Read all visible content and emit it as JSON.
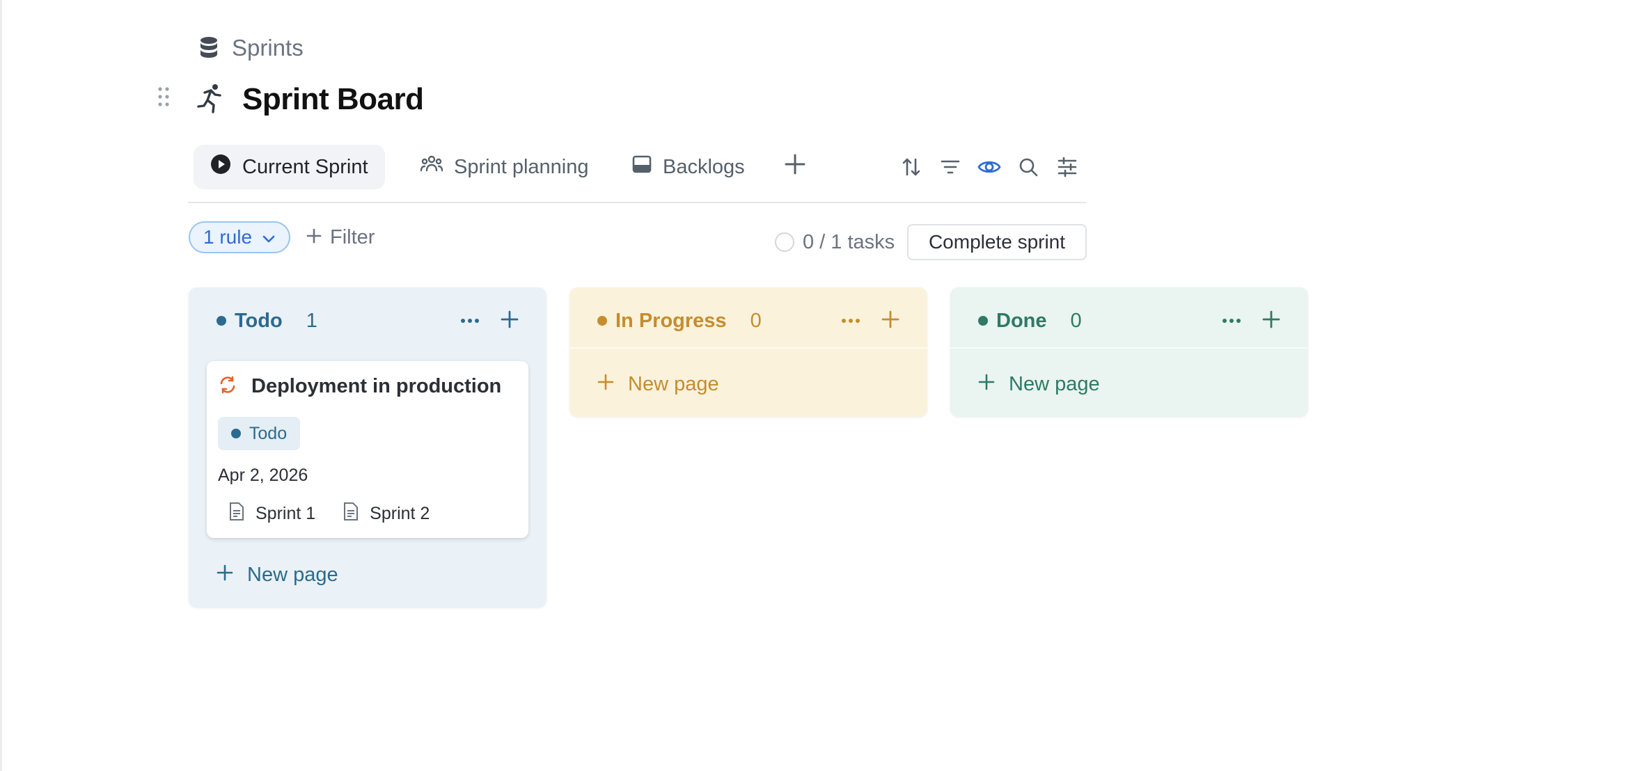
{
  "breadcrumb": {
    "label": "Sprints",
    "icon": "database-icon"
  },
  "page": {
    "title": "Sprint Board",
    "icon": "running-person-icon"
  },
  "tabs": [
    {
      "label": "Current Sprint",
      "icon": "play-circle-icon",
      "active": true
    },
    {
      "label": "Sprint planning",
      "icon": "people-icon",
      "active": false
    },
    {
      "label": "Backlogs",
      "icon": "inbox-icon",
      "active": false
    }
  ],
  "toolbar": {
    "icons": [
      "sort-icon",
      "filter-icon",
      "eye-icon",
      "search-icon",
      "settings-sliders-icon"
    ],
    "accent": "#2f6bd6"
  },
  "filters": {
    "rule_label": "1 rule",
    "filter_label": "Filter",
    "tasks": "0 / 1 tasks",
    "complete_label": "Complete sprint"
  },
  "columns": [
    {
      "name": "Todo",
      "count": "1",
      "color": "#2c6a8e",
      "new_page": "New page",
      "cards": [
        {
          "title": "Deployment in production",
          "status": "Todo",
          "date": "Apr 2, 2026",
          "relations": [
            "Sprint 1",
            "Sprint 2"
          ]
        }
      ]
    },
    {
      "name": "In Progress",
      "count": "0",
      "color": "#c48d2e",
      "new_page": "New page"
    },
    {
      "name": "Done",
      "count": "0",
      "color": "#2e7a65",
      "new_page": "New page"
    }
  ]
}
